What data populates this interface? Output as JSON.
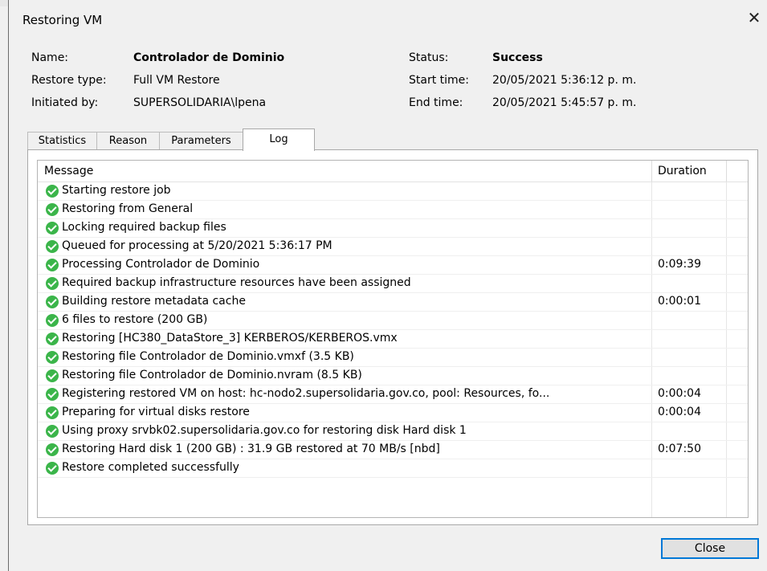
{
  "window": {
    "title": "Restoring VM"
  },
  "info": {
    "name_label": "Name:",
    "name_value": "Controlador de Dominio",
    "restore_type_label": "Restore type:",
    "restore_type_value": "Full VM Restore",
    "initiated_by_label": "Initiated by:",
    "initiated_by_value": "SUPERSOLIDARIA\\lpena",
    "status_label": "Status:",
    "status_value": "Success",
    "start_time_label": "Start time:",
    "start_time_value": "20/05/2021 5:36:12 p. m.",
    "end_time_label": "End time:",
    "end_time_value": "20/05/2021 5:45:57 p. m."
  },
  "tabs": [
    {
      "label": "Statistics"
    },
    {
      "label": "Reason"
    },
    {
      "label": "Parameters"
    },
    {
      "label": "Log",
      "active": true
    }
  ],
  "log": {
    "headers": {
      "message": "Message",
      "duration": "Duration"
    },
    "status_icon": "success-check-icon",
    "status_color": "#3bb54a",
    "rows": [
      {
        "message": "Starting restore job",
        "duration": ""
      },
      {
        "message": "Restoring from General",
        "duration": ""
      },
      {
        "message": "Locking required backup files",
        "duration": ""
      },
      {
        "message": "Queued for processing at 5/20/2021 5:36:17 PM",
        "duration": ""
      },
      {
        "message": "Processing Controlador de Dominio",
        "duration": "0:09:39"
      },
      {
        "message": "Required backup infrastructure resources have been assigned",
        "duration": ""
      },
      {
        "message": "Building restore metadata cache",
        "duration": "0:00:01"
      },
      {
        "message": "6 files to restore (200 GB)",
        "duration": ""
      },
      {
        "message": "Restoring [HC380_DataStore_3] KERBEROS/KERBEROS.vmx",
        "duration": ""
      },
      {
        "message": "Restoring file Controlador de Dominio.vmxf (3.5 KB)",
        "duration": ""
      },
      {
        "message": "Restoring file Controlador de Dominio.nvram (8.5 KB)",
        "duration": ""
      },
      {
        "message": "Registering restored VM on host: hc-nodo2.supersolidaria.gov.co, pool: Resources, fo...",
        "duration": "0:00:04"
      },
      {
        "message": "Preparing for virtual disks restore",
        "duration": "0:00:04"
      },
      {
        "message": "Using proxy srvbk02.supersolidaria.gov.co for restoring disk Hard disk 1",
        "duration": ""
      },
      {
        "message": "Restoring Hard disk 1 (200 GB) : 31.9 GB restored at 70 MB/s  [nbd]",
        "duration": "0:07:50"
      },
      {
        "message": "Restore completed successfully",
        "duration": ""
      }
    ]
  },
  "buttons": {
    "close_label": "Close",
    "close_icon": "close-icon"
  },
  "colors": {
    "accent": "#0078d7",
    "background": "#f0f0f0"
  }
}
